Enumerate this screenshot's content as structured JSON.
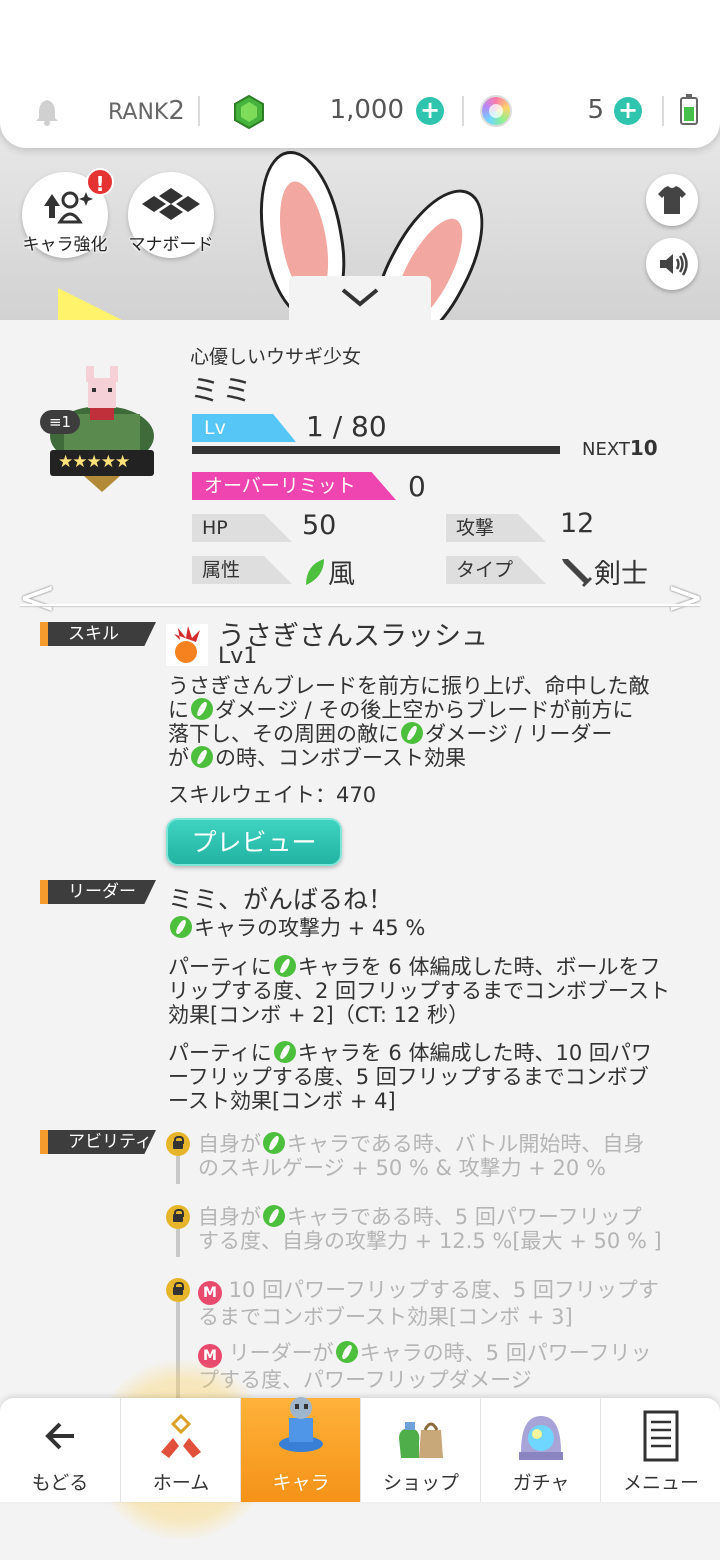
{
  "topbar": {
    "rank_label": "RANK",
    "rank_value": "2",
    "gems": "1,000",
    "orbs": "5",
    "icons": [
      "bell-icon",
      "gem-icon",
      "plus-icon",
      "orb-icon",
      "battery-icon"
    ]
  },
  "hero": {
    "upgrade_label": "キャラ強化",
    "upgrade_badge": "!",
    "manaboard_label": "マナボード"
  },
  "character": {
    "epithet": "心優しいウサギ少女",
    "name": "ミミ",
    "stack": "1",
    "stars": "★★★★★",
    "lv_label": "Lv",
    "lv_value": "1 / 80",
    "next_label": "NEXT",
    "next_value": "10",
    "overlimit_label": "オーバーリミット",
    "overlimit_value": "0",
    "hp_label": "HP",
    "hp_value": "50",
    "attack_label": "攻撃",
    "attack_value": "12",
    "element_label": "属性",
    "element_value": "風",
    "type_label": "タイプ",
    "type_value": "剣士"
  },
  "skill": {
    "section_label": "スキル",
    "name": "うさぎさんスラッシュ",
    "level": "Lv1",
    "desc_1": "うさぎさんブレードを前方に振り上げ、命中した敵",
    "desc_2": "ダメージ / その後上空からブレードが前方に",
    "desc_3": "落下し、その周囲の敵に",
    "desc_4": "ダメージ / リーダー",
    "desc_5": "が",
    "desc_6": "の時、コンボブースト効果",
    "desc_pre2": "に",
    "weight": "スキルウェイト：470",
    "preview_label": "プレビュー"
  },
  "leader": {
    "section_label": "リーダー",
    "title": "ミミ、がんばるね！",
    "effect_1": "キャラの攻撃力 + 45 %",
    "effect_2a": "パーティに",
    "effect_2b": "キャラを 6 体編成した時、ボールをフ",
    "effect_2c": "リップする度、2 回フリップするまでコンボブースト",
    "effect_2d": "効果[コンボ + 2]（CT: 12 秒）",
    "effect_3a": "パーティに",
    "effect_3b": "キャラを 6 体編成した時、10 回パワ",
    "effect_3c": "ーフリップする度、5 回フリップするまでコンボブ",
    "effect_3d": "ースト効果[コンボ + 4]"
  },
  "ability": {
    "section_label": "アビリティ",
    "a1a": "自身が",
    "a1b": "キャラである時、バトル開始時、自身",
    "a1c": "のスキルゲージ + 50 % & 攻撃力 + 20 %",
    "a2a": "自身が",
    "a2b": "キャラである時、5 回パワーフリップ",
    "a2c": "する度、自身の攻撃力 + 12.5 %[最大 + 50 % ]",
    "a3a": "10 回パワーフリップする度、5 回フリップす",
    "a3b": "るまでコンボブースト効果[コンボ + 3]",
    "a4a": "リーダーが",
    "a4b": "キャラの時、5 回パワーフリッ",
    "a4c": "プする度、パワーフリップダメージ",
    "m_badge": "M"
  },
  "bottomnav": {
    "back": "もどる",
    "home": "ホーム",
    "chara": "キャラ",
    "shop": "ショップ",
    "gacha": "ガチャ",
    "menu": "メニュー"
  },
  "colors": {
    "accent_teal": "#2fc4ae",
    "lv_blue": "#55c6f5",
    "overlimit_pink": "#ee45b0",
    "wind_green": "#4cbf3c",
    "section_orange": "#f59b2d",
    "nav_active": "#f59218"
  }
}
